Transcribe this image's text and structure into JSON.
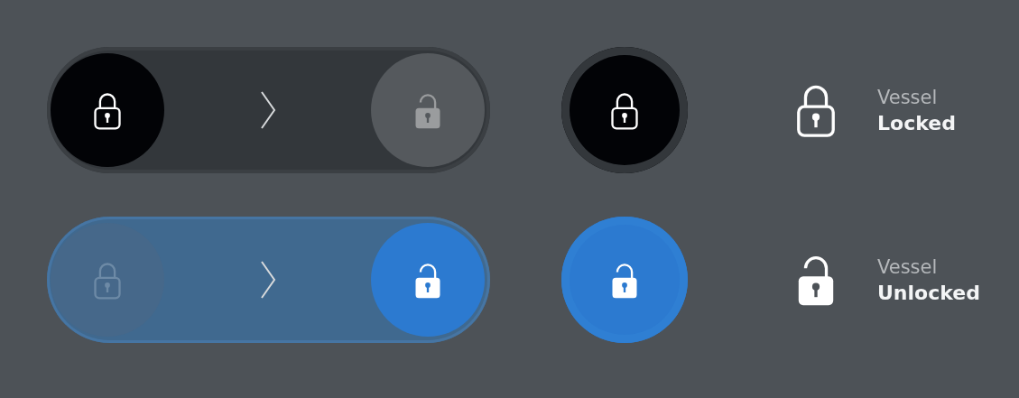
{
  "rows": [
    {
      "locked": true,
      "label": "Vessel",
      "status": "Locked"
    },
    {
      "locked": false,
      "label": "Vessel",
      "status": "Unlocked"
    }
  ]
}
